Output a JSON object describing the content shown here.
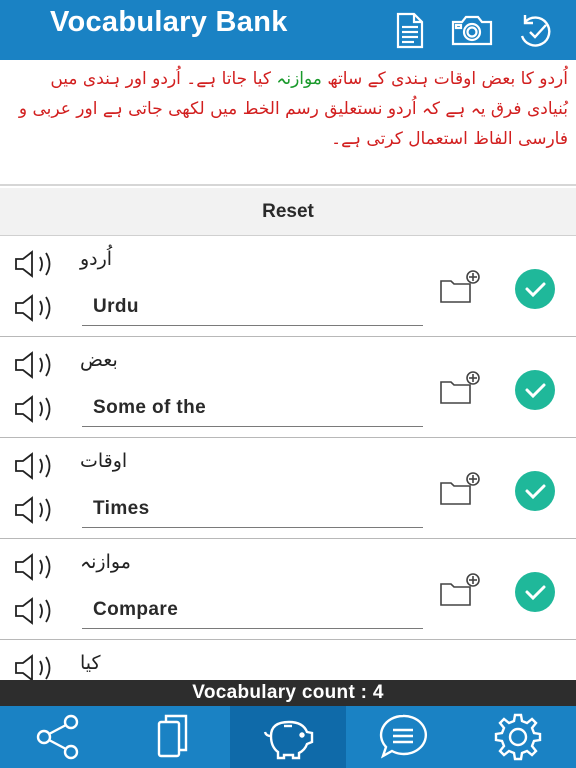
{
  "header": {
    "title": "Vocabulary Bank",
    "icons": [
      "document-icon",
      "camera-icon",
      "history-icon"
    ]
  },
  "passage": {
    "part1": "اُردو کا بعض اوقات ہندی کے ساتھ",
    "part2": "موازنہ",
    "part3": "کیا جاتا ہے۔ اُردو اور ہندی میں بُنیادی فرق یہ ہے کہ اُردو نستعلیق رسم الخط میں لکھی جاتی ہے اور عربی و فارسی الفاظ استعمال کرتی ہے۔"
  },
  "reset_label": "Reset",
  "entries": [
    {
      "word": "اُردو",
      "meaning": "Urdu"
    },
    {
      "word": "بعض",
      "meaning": "Some of the"
    },
    {
      "word": "اوقات",
      "meaning": "Times"
    },
    {
      "word": "موازنہ",
      "meaning": "Compare"
    },
    {
      "word": "کیا",
      "meaning": ""
    }
  ],
  "count_label": "Vocabulary count : 4",
  "tabs": [
    "share-icon",
    "copy-icon",
    "piggy-bank-icon",
    "chat-icon",
    "settings-icon"
  ],
  "colors": {
    "header_blue": "#1a82c4",
    "active_tab": "#0f6aa9",
    "passage_red": "#d21f1f",
    "passage_green": "#1a9a2c",
    "check_teal": "#1fb89a"
  }
}
